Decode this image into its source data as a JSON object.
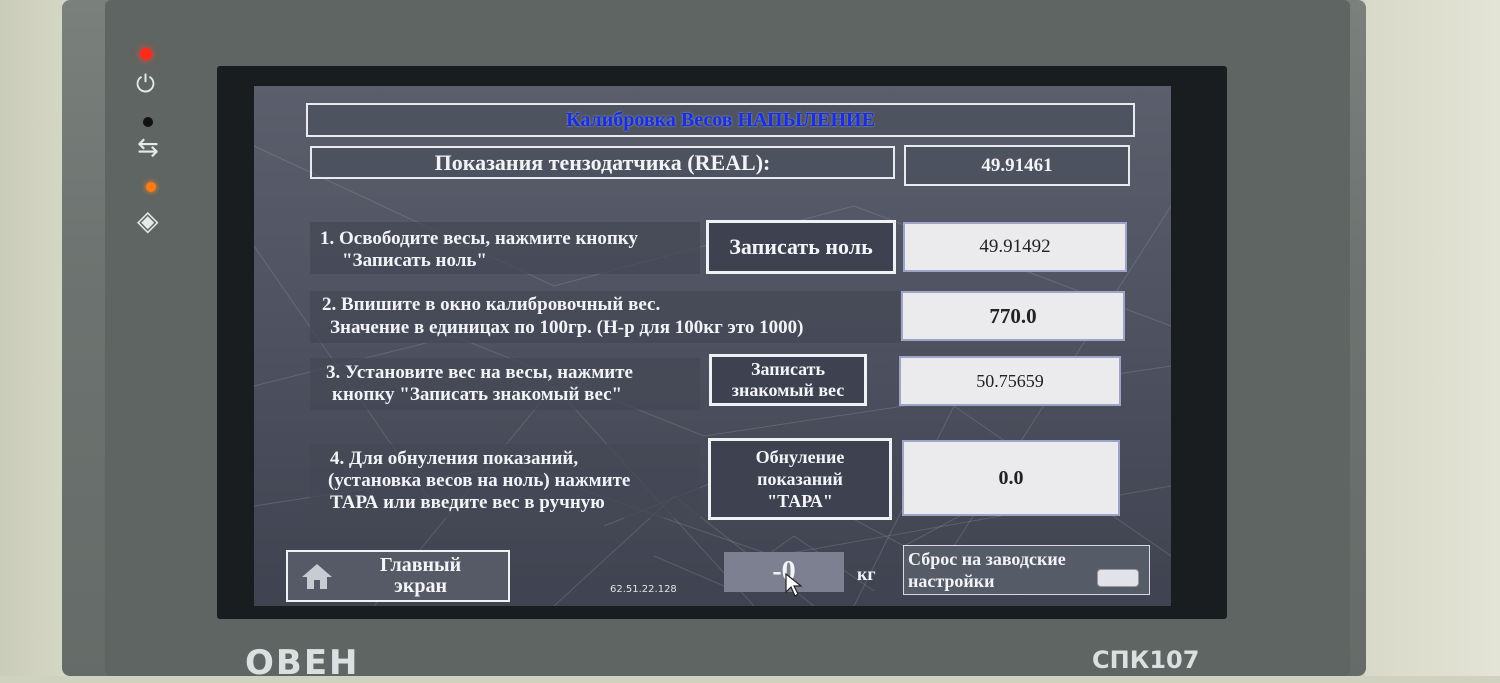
{
  "panel": {
    "brand": "ОВЕН",
    "model": "СПК107"
  },
  "screen": {
    "title": "Калибровка Весов НАПЫЛЕНИЕ",
    "sensor": {
      "label": "Показания тензодатчика (REAL):",
      "value": "49.91461"
    },
    "steps": [
      {
        "text_lines": [
          "1. Освободите весы, нажмите кнопку",
          "\"Записать ноль\""
        ],
        "button_lines": [
          "Записать ноль"
        ],
        "value": "49.91492"
      },
      {
        "text_lines": [
          "2. Впишите в окно калибровочный вес.",
          "Значение в единицах по 100гр. (Н-р для 100кг это 1000)"
        ],
        "button_lines": [],
        "value": "770.0"
      },
      {
        "text_lines": [
          "3. Установите вес на весы, нажмите",
          "кнопку \"Записать знакомый вес\""
        ],
        "button_lines": [
          "Записать",
          "знакомый вес"
        ],
        "value": "50.75659"
      },
      {
        "text_lines": [
          "4. Для обнуления показаний,",
          "(установка весов на ноль) нажмите",
          "ТАРА или введите вес в ручную"
        ],
        "button_lines": [
          "Обнуление",
          "показаний",
          "\"ТАРА\""
        ],
        "value": "0.0"
      }
    ],
    "footer": {
      "home_lines": [
        "Главный",
        "экран"
      ],
      "ip": "62.51.22.128",
      "weight_value": "-0",
      "weight_unit": "кг",
      "reset_lines": [
        "Сброс на заводские",
        "настройки"
      ]
    }
  },
  "colors": {
    "title": "#1a2fd8",
    "led_red": "#ff2a1a",
    "led_amber": "#ff7a10"
  }
}
